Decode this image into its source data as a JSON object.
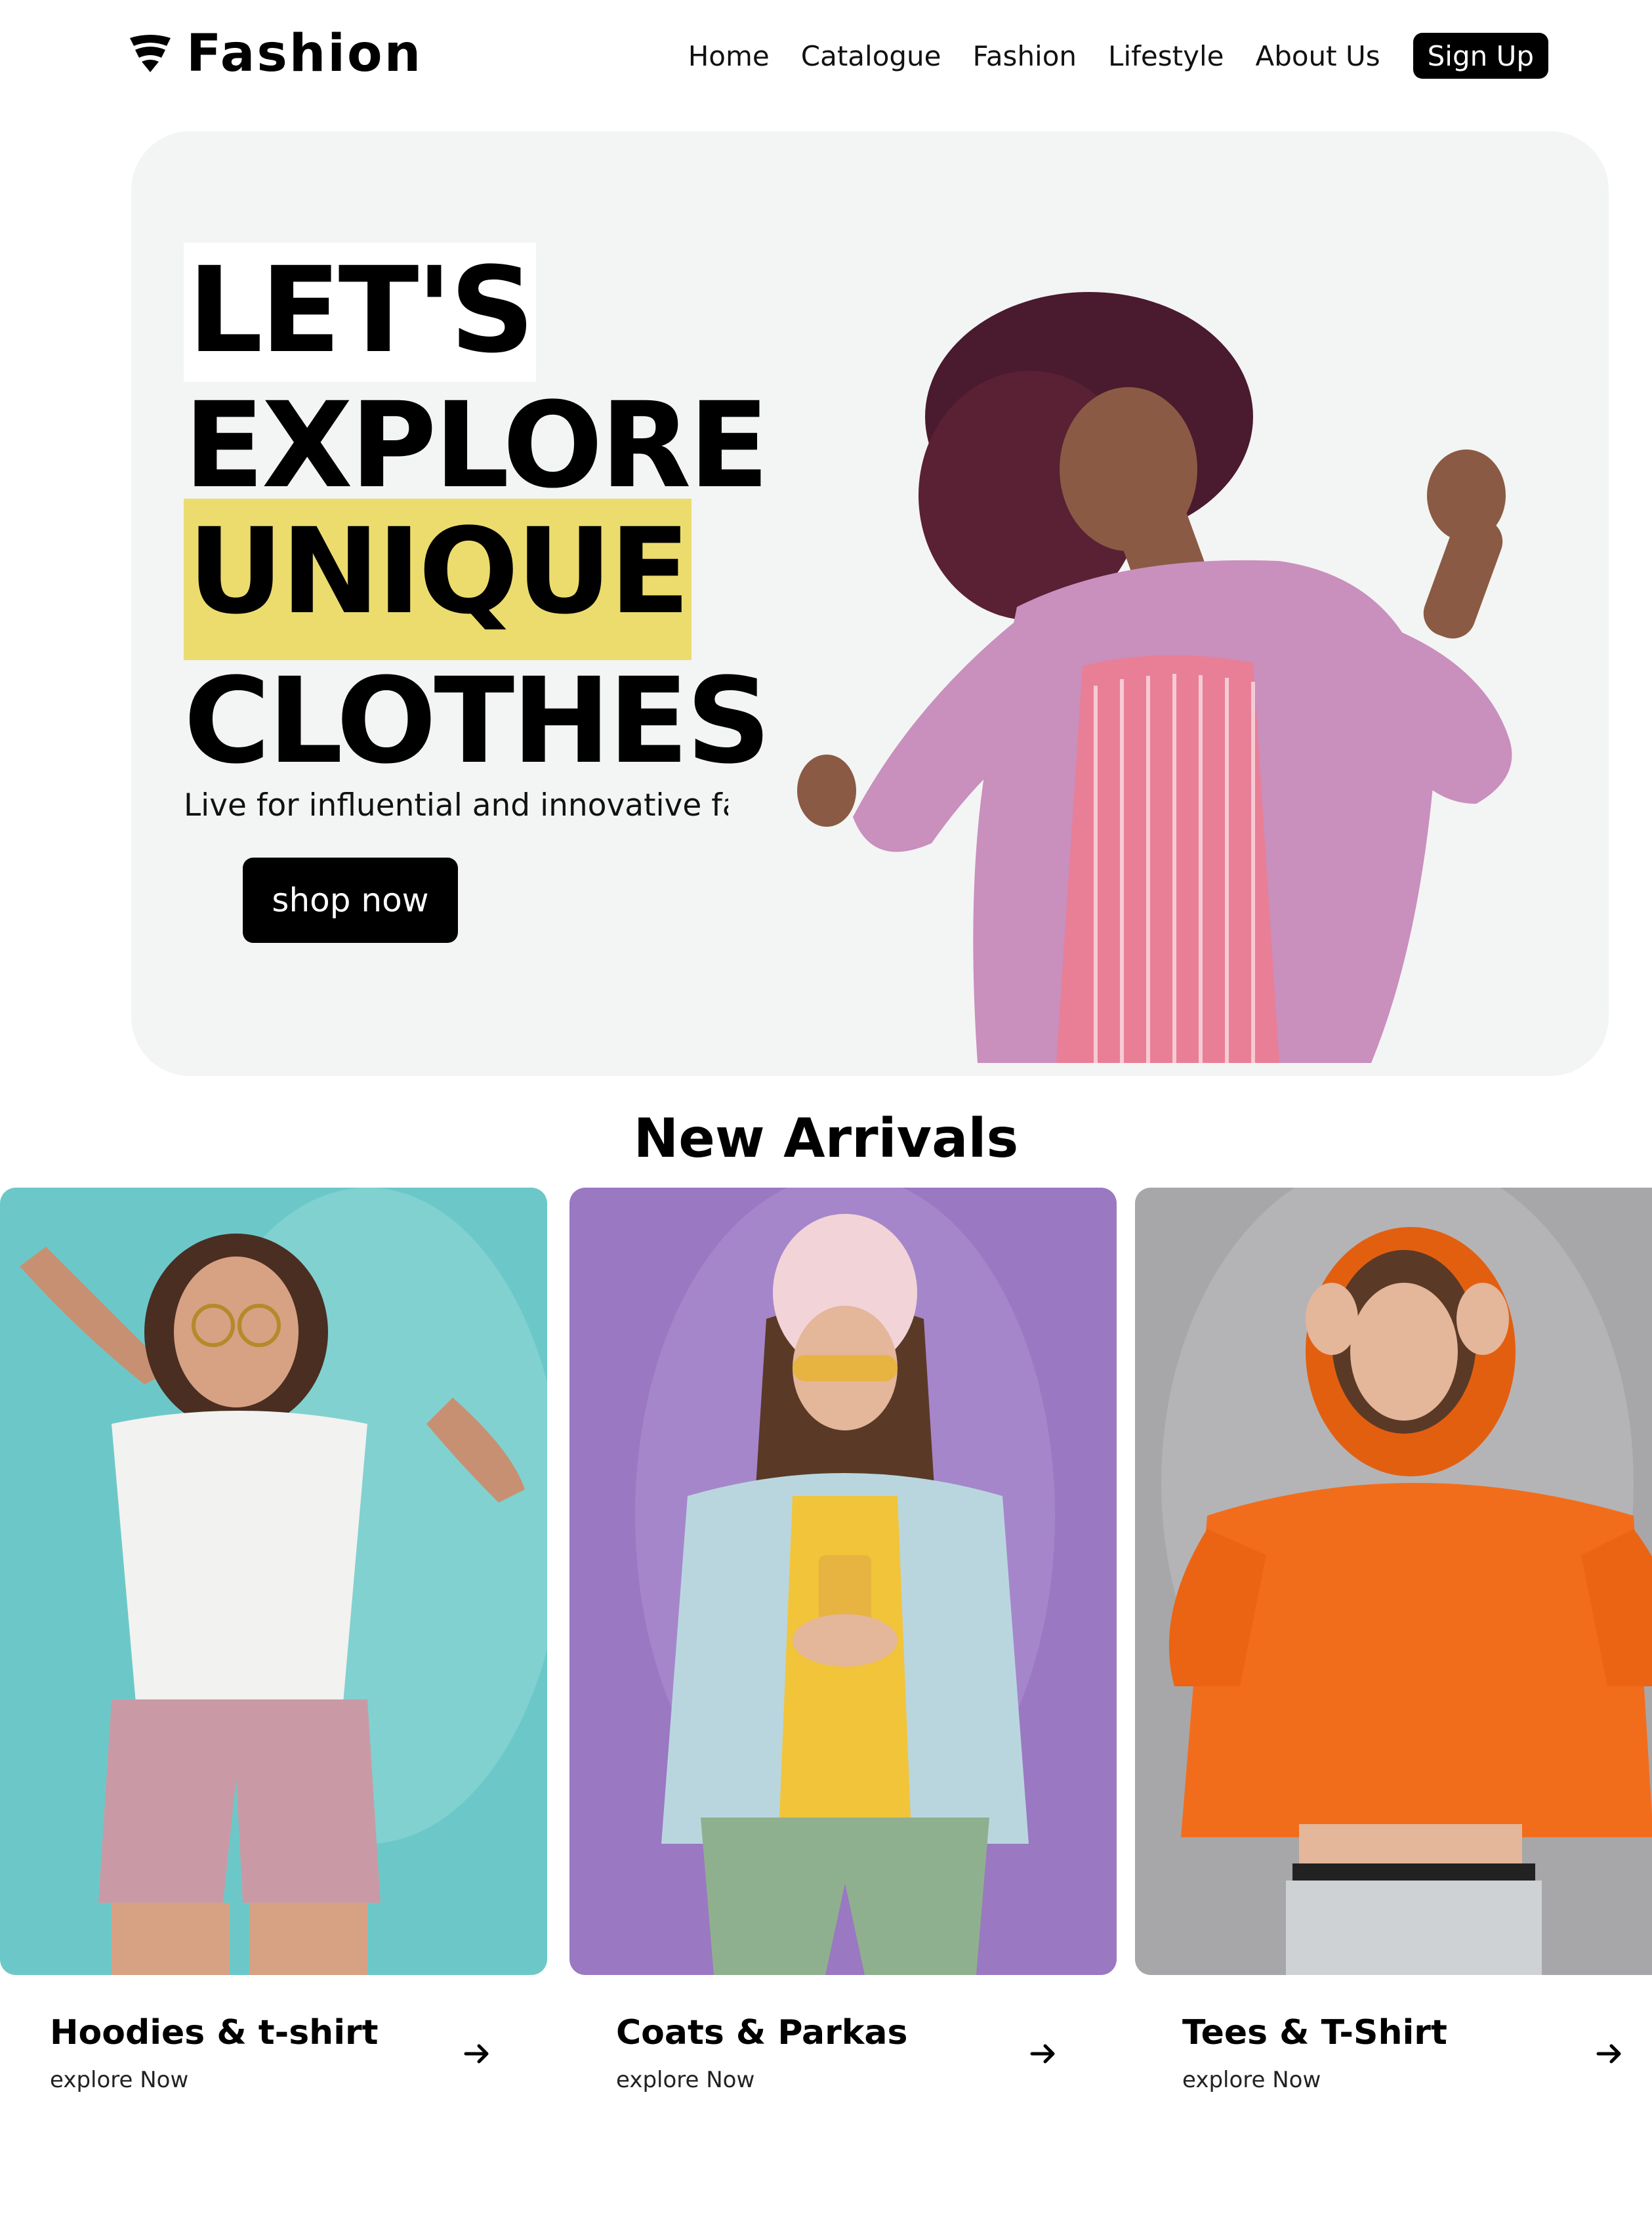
{
  "header": {
    "brand": "Fashion",
    "logo_icon": "wifi-shield-logo-icon",
    "nav": [
      {
        "label": "Home"
      },
      {
        "label": "Catalogue"
      },
      {
        "label": "Fashion"
      },
      {
        "label": "Lifestyle"
      },
      {
        "label": "About Us"
      }
    ],
    "signup_label": "Sign Up"
  },
  "hero": {
    "lines": [
      "LET'S",
      "EXPLORE",
      "UNIQUE",
      "CLOTHES"
    ],
    "highlight_color": "#ecdc6d",
    "subtitle": "Live for influential and innovative fashion!",
    "cta_label": "shop now",
    "background": "#f3f4f4"
  },
  "arrivals": {
    "title": "New Arrivals",
    "cards": [
      {
        "title": "Hoodies & t-shirt",
        "subtitle": "explore Now",
        "bg": "#6cc8c8",
        "arrow_icon": "arrow-right-icon"
      },
      {
        "title": "Coats & Parkas",
        "subtitle": "explore Now",
        "bg": "#9a78c2",
        "arrow_icon": "arrow-right-icon"
      },
      {
        "title": "Tees & T-Shirt",
        "subtitle": "explore Now",
        "bg": "#a7a7a9",
        "arrow_icon": "arrow-right-icon"
      }
    ]
  }
}
